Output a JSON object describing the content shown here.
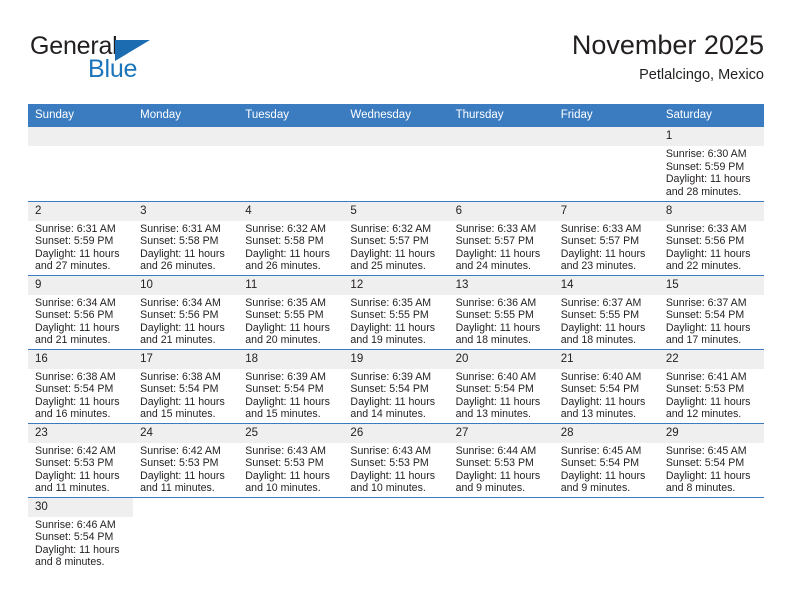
{
  "brand": {
    "name_part1": "General",
    "name_part2": "Blue",
    "triangle_color": "#1b6cb0",
    "blue_color": "#1b75bb"
  },
  "header": {
    "title": "November 2025",
    "subtitle": "Petlalcingo, Mexico"
  },
  "theme": {
    "header_bg": "#3b7cc0",
    "header_text": "#ffffff",
    "daynum_bg": "#efefef",
    "separator": "#3b7cc0",
    "text": "#231f20"
  },
  "weekday_headers": [
    "Sunday",
    "Monday",
    "Tuesday",
    "Wednesday",
    "Thursday",
    "Friday",
    "Saturday"
  ],
  "weeks": [
    [
      {
        "day": "",
        "sunrise": "",
        "sunset": "",
        "daylight": "",
        "empty": true
      },
      {
        "day": "",
        "sunrise": "",
        "sunset": "",
        "daylight": "",
        "empty": true
      },
      {
        "day": "",
        "sunrise": "",
        "sunset": "",
        "daylight": "",
        "empty": true
      },
      {
        "day": "",
        "sunrise": "",
        "sunset": "",
        "daylight": "",
        "empty": true
      },
      {
        "day": "",
        "sunrise": "",
        "sunset": "",
        "daylight": "",
        "empty": true
      },
      {
        "day": "",
        "sunrise": "",
        "sunset": "",
        "daylight": "",
        "empty": true
      },
      {
        "day": "1",
        "sunrise": "Sunrise: 6:30 AM",
        "sunset": "Sunset: 5:59 PM",
        "daylight": "Daylight: 11 hours and 28 minutes."
      }
    ],
    [
      {
        "day": "2",
        "sunrise": "Sunrise: 6:31 AM",
        "sunset": "Sunset: 5:59 PM",
        "daylight": "Daylight: 11 hours and 27 minutes."
      },
      {
        "day": "3",
        "sunrise": "Sunrise: 6:31 AM",
        "sunset": "Sunset: 5:58 PM",
        "daylight": "Daylight: 11 hours and 26 minutes."
      },
      {
        "day": "4",
        "sunrise": "Sunrise: 6:32 AM",
        "sunset": "Sunset: 5:58 PM",
        "daylight": "Daylight: 11 hours and 26 minutes."
      },
      {
        "day": "5",
        "sunrise": "Sunrise: 6:32 AM",
        "sunset": "Sunset: 5:57 PM",
        "daylight": "Daylight: 11 hours and 25 minutes."
      },
      {
        "day": "6",
        "sunrise": "Sunrise: 6:33 AM",
        "sunset": "Sunset: 5:57 PM",
        "daylight": "Daylight: 11 hours and 24 minutes."
      },
      {
        "day": "7",
        "sunrise": "Sunrise: 6:33 AM",
        "sunset": "Sunset: 5:57 PM",
        "daylight": "Daylight: 11 hours and 23 minutes."
      },
      {
        "day": "8",
        "sunrise": "Sunrise: 6:33 AM",
        "sunset": "Sunset: 5:56 PM",
        "daylight": "Daylight: 11 hours and 22 minutes."
      }
    ],
    [
      {
        "day": "9",
        "sunrise": "Sunrise: 6:34 AM",
        "sunset": "Sunset: 5:56 PM",
        "daylight": "Daylight: 11 hours and 21 minutes."
      },
      {
        "day": "10",
        "sunrise": "Sunrise: 6:34 AM",
        "sunset": "Sunset: 5:56 PM",
        "daylight": "Daylight: 11 hours and 21 minutes."
      },
      {
        "day": "11",
        "sunrise": "Sunrise: 6:35 AM",
        "sunset": "Sunset: 5:55 PM",
        "daylight": "Daylight: 11 hours and 20 minutes."
      },
      {
        "day": "12",
        "sunrise": "Sunrise: 6:35 AM",
        "sunset": "Sunset: 5:55 PM",
        "daylight": "Daylight: 11 hours and 19 minutes."
      },
      {
        "day": "13",
        "sunrise": "Sunrise: 6:36 AM",
        "sunset": "Sunset: 5:55 PM",
        "daylight": "Daylight: 11 hours and 18 minutes."
      },
      {
        "day": "14",
        "sunrise": "Sunrise: 6:37 AM",
        "sunset": "Sunset: 5:55 PM",
        "daylight": "Daylight: 11 hours and 18 minutes."
      },
      {
        "day": "15",
        "sunrise": "Sunrise: 6:37 AM",
        "sunset": "Sunset: 5:54 PM",
        "daylight": "Daylight: 11 hours and 17 minutes."
      }
    ],
    [
      {
        "day": "16",
        "sunrise": "Sunrise: 6:38 AM",
        "sunset": "Sunset: 5:54 PM",
        "daylight": "Daylight: 11 hours and 16 minutes."
      },
      {
        "day": "17",
        "sunrise": "Sunrise: 6:38 AM",
        "sunset": "Sunset: 5:54 PM",
        "daylight": "Daylight: 11 hours and 15 minutes."
      },
      {
        "day": "18",
        "sunrise": "Sunrise: 6:39 AM",
        "sunset": "Sunset: 5:54 PM",
        "daylight": "Daylight: 11 hours and 15 minutes."
      },
      {
        "day": "19",
        "sunrise": "Sunrise: 6:39 AM",
        "sunset": "Sunset: 5:54 PM",
        "daylight": "Daylight: 11 hours and 14 minutes."
      },
      {
        "day": "20",
        "sunrise": "Sunrise: 6:40 AM",
        "sunset": "Sunset: 5:54 PM",
        "daylight": "Daylight: 11 hours and 13 minutes."
      },
      {
        "day": "21",
        "sunrise": "Sunrise: 6:40 AM",
        "sunset": "Sunset: 5:54 PM",
        "daylight": "Daylight: 11 hours and 13 minutes."
      },
      {
        "day": "22",
        "sunrise": "Sunrise: 6:41 AM",
        "sunset": "Sunset: 5:53 PM",
        "daylight": "Daylight: 11 hours and 12 minutes."
      }
    ],
    [
      {
        "day": "23",
        "sunrise": "Sunrise: 6:42 AM",
        "sunset": "Sunset: 5:53 PM",
        "daylight": "Daylight: 11 hours and 11 minutes."
      },
      {
        "day": "24",
        "sunrise": "Sunrise: 6:42 AM",
        "sunset": "Sunset: 5:53 PM",
        "daylight": "Daylight: 11 hours and 11 minutes."
      },
      {
        "day": "25",
        "sunrise": "Sunrise: 6:43 AM",
        "sunset": "Sunset: 5:53 PM",
        "daylight": "Daylight: 11 hours and 10 minutes."
      },
      {
        "day": "26",
        "sunrise": "Sunrise: 6:43 AM",
        "sunset": "Sunset: 5:53 PM",
        "daylight": "Daylight: 11 hours and 10 minutes."
      },
      {
        "day": "27",
        "sunrise": "Sunrise: 6:44 AM",
        "sunset": "Sunset: 5:53 PM",
        "daylight": "Daylight: 11 hours and 9 minutes."
      },
      {
        "day": "28",
        "sunrise": "Sunrise: 6:45 AM",
        "sunset": "Sunset: 5:54 PM",
        "daylight": "Daylight: 11 hours and 9 minutes."
      },
      {
        "day": "29",
        "sunrise": "Sunrise: 6:45 AM",
        "sunset": "Sunset: 5:54 PM",
        "daylight": "Daylight: 11 hours and 8 minutes."
      }
    ],
    [
      {
        "day": "30",
        "sunrise": "Sunrise: 6:46 AM",
        "sunset": "Sunset: 5:54 PM",
        "daylight": "Daylight: 11 hours and 8 minutes."
      },
      {
        "day": "",
        "sunrise": "",
        "sunset": "",
        "daylight": "",
        "blank": true
      },
      {
        "day": "",
        "sunrise": "",
        "sunset": "",
        "daylight": "",
        "blank": true
      },
      {
        "day": "",
        "sunrise": "",
        "sunset": "",
        "daylight": "",
        "blank": true
      },
      {
        "day": "",
        "sunrise": "",
        "sunset": "",
        "daylight": "",
        "blank": true
      },
      {
        "day": "",
        "sunrise": "",
        "sunset": "",
        "daylight": "",
        "blank": true
      },
      {
        "day": "",
        "sunrise": "",
        "sunset": "",
        "daylight": "",
        "blank": true
      }
    ]
  ]
}
